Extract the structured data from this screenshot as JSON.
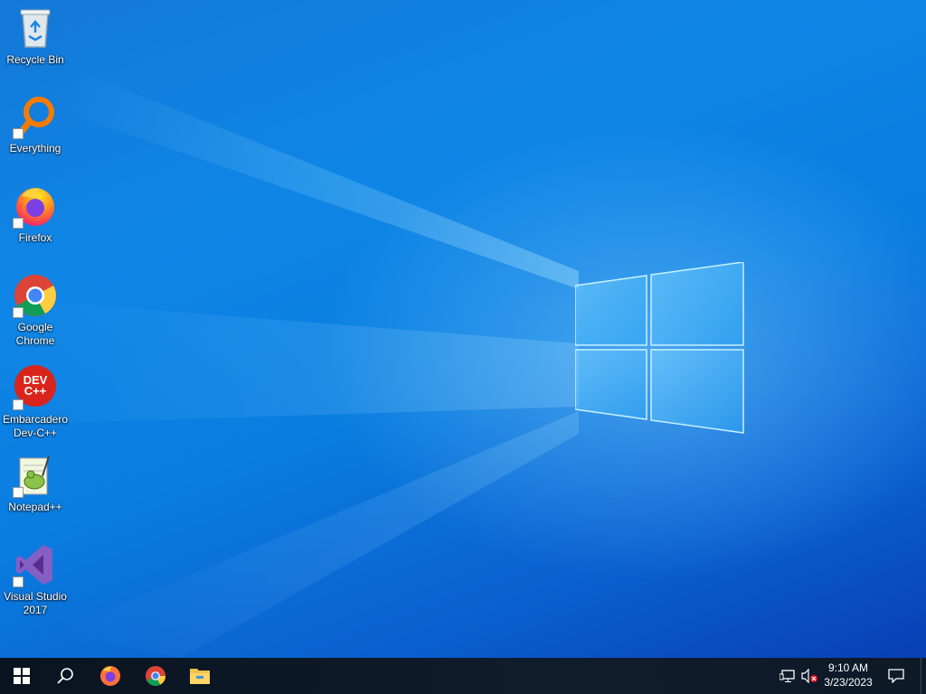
{
  "desktop": {
    "icons": [
      {
        "label": "Recycle Bin",
        "icon": "recycle-bin-icon"
      },
      {
        "label": "Everything",
        "icon": "everything-search-icon"
      },
      {
        "label": "Firefox",
        "icon": "firefox-icon"
      },
      {
        "label": "Google\nChrome",
        "icon": "chrome-icon"
      },
      {
        "label": "Embarcadero\nDev-C++",
        "icon": "devcpp-icon"
      },
      {
        "label": "Notepad++",
        "icon": "notepadpp-icon"
      },
      {
        "label": "Visual Studio\n2017",
        "icon": "visual-studio-icon"
      }
    ],
    "devcpp_logo_text": "DEV\nC++"
  },
  "taskbar": {
    "start": "windows-start-icon",
    "search": "search-icon",
    "pinned": [
      "firefox-icon",
      "chrome-icon",
      "file-explorer-icon"
    ],
    "tray": {
      "network": "network-icon",
      "volume": "volume-muted-icon",
      "notifications": "notifications-icon"
    },
    "clock": {
      "time": "9:10 AM",
      "date": "3/23/2023"
    }
  },
  "colors": {
    "taskbar": "#0d1b2a",
    "desktop_accent": "#0a7de0"
  }
}
